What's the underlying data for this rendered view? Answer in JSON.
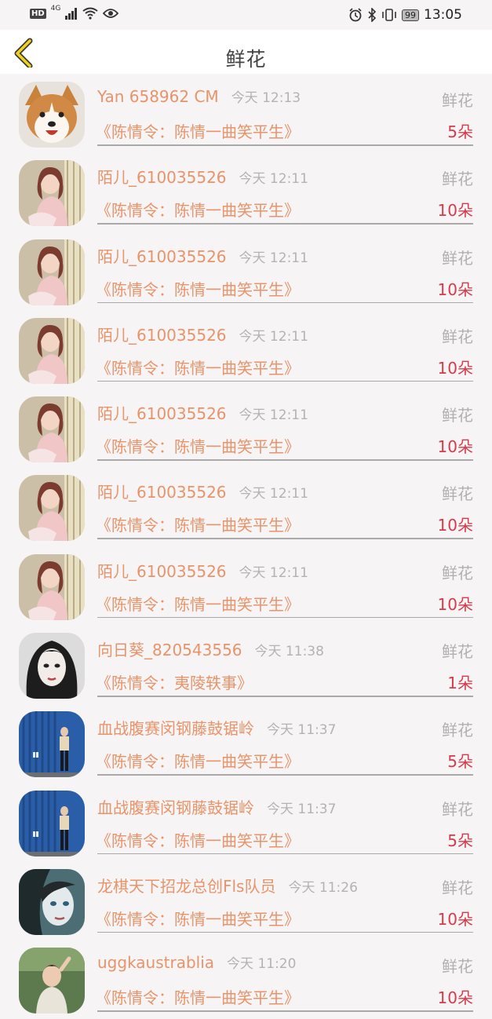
{
  "status_bar": {
    "network": "HD",
    "signal": "4G",
    "battery": "99",
    "time": "13:05"
  },
  "header": {
    "title": "鲜花"
  },
  "records": [
    {
      "user": "Yan 658962 CM",
      "time": "今天 12:13",
      "type": "鲜花",
      "drama": "《陈情令：陈情一曲笑平生》",
      "count": "5朵",
      "avatar": "dog"
    },
    {
      "user": "陌儿_610035526",
      "time": "今天 12:11",
      "type": "鲜花",
      "drama": "《陈情令：陈情一曲笑平生》",
      "count": "10朵",
      "avatar": "girl-pink"
    },
    {
      "user": "陌儿_610035526",
      "time": "今天 12:11",
      "type": "鲜花",
      "drama": "《陈情令：陈情一曲笑平生》",
      "count": "10朵",
      "avatar": "girl-pink"
    },
    {
      "user": "陌儿_610035526",
      "time": "今天 12:11",
      "type": "鲜花",
      "drama": "《陈情令：陈情一曲笑平生》",
      "count": "10朵",
      "avatar": "girl-pink"
    },
    {
      "user": "陌儿_610035526",
      "time": "今天 12:11",
      "type": "鲜花",
      "drama": "《陈情令：陈情一曲笑平生》",
      "count": "10朵",
      "avatar": "girl-pink"
    },
    {
      "user": "陌儿_610035526",
      "time": "今天 12:11",
      "type": "鲜花",
      "drama": "《陈情令：陈情一曲笑平生》",
      "count": "10朵",
      "avatar": "girl-pink"
    },
    {
      "user": "陌儿_610035526",
      "time": "今天 12:11",
      "type": "鲜花",
      "drama": "《陈情令：陈情一曲笑平生》",
      "count": "10朵",
      "avatar": "girl-pink"
    },
    {
      "user": "向日葵_820543556",
      "time": "今天 11:38",
      "type": "鲜花",
      "drama": "《陈情令：夷陵轶事》",
      "count": "1朵",
      "avatar": "girl-dark"
    },
    {
      "user": "血战腹赛闵钢藤鼓锯岭",
      "time": "今天 11:37",
      "type": "鲜花",
      "drama": "《陈情令：陈情一曲笑平生》",
      "count": "5朵",
      "avatar": "blue-container"
    },
    {
      "user": "血战腹赛闵钢藤鼓锯岭",
      "time": "今天 11:37",
      "type": "鲜花",
      "drama": "《陈情令：陈情一曲笑平生》",
      "count": "5朵",
      "avatar": "blue-container"
    },
    {
      "user": "龙棋天下招龙总创Fls队员",
      "time": "今天 11:26",
      "type": "鲜花",
      "drama": "《陈情令：陈情一曲笑平生》",
      "count": "10朵",
      "avatar": "girl-teal"
    },
    {
      "user": "uggkaustrablia",
      "time": "今天 11:20",
      "type": "鲜花",
      "drama": "《陈情令：陈情一曲笑平生》",
      "count": "10朵",
      "avatar": "girl-green"
    }
  ]
}
